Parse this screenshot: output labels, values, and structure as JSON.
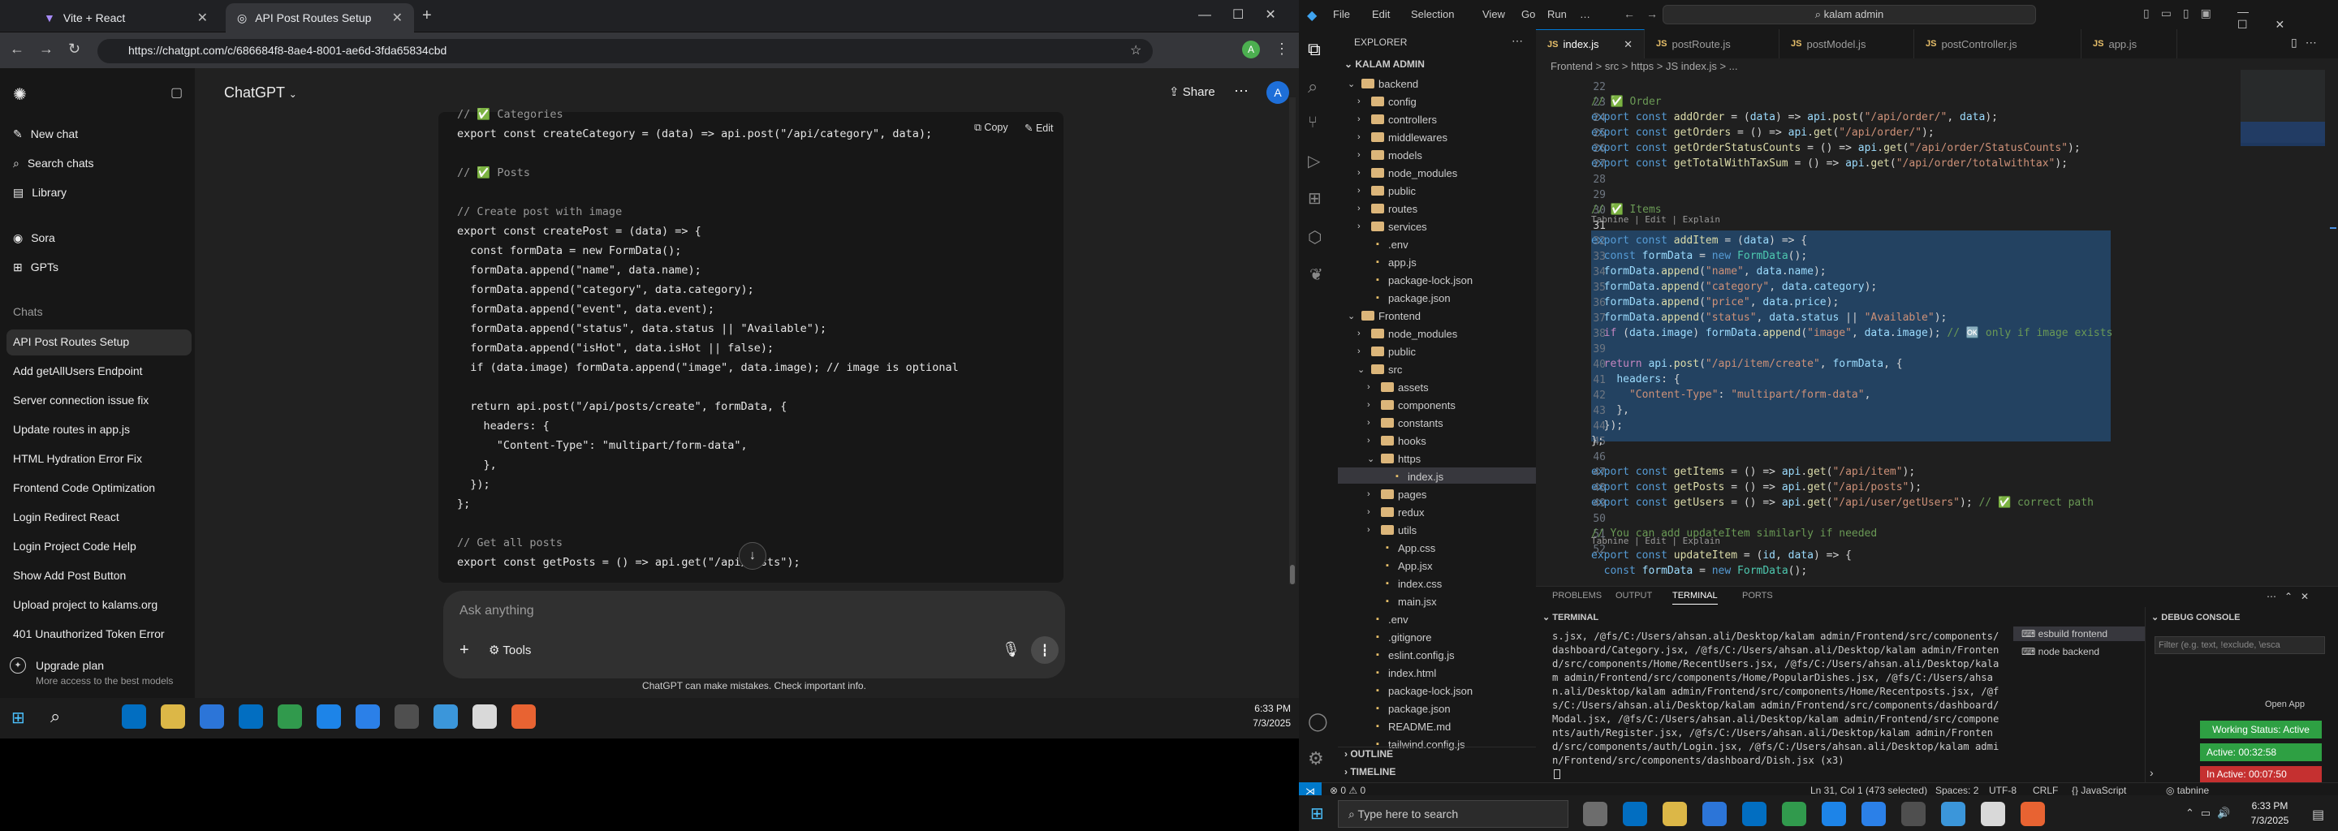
{
  "chrome": {
    "tabs": [
      "Vite + React",
      "API Post Routes Setup"
    ],
    "url": "https://chatgpt.com/c/686684f8-8ae4-8001-ae6d-3fda65834cbd"
  },
  "chatgpt": {
    "brand": "ChatGPT",
    "nav": [
      "New chat",
      "Search chats",
      "Library",
      "Sora",
      "GPTs"
    ],
    "chats_heading": "Chats",
    "history": [
      "API Post Routes Setup",
      "Add getAllUsers Endpoint",
      "Server connection issue fix",
      "Update routes in app.js",
      "HTML Hydration Error Fix",
      "Frontend Code Optimization",
      "Login Redirect React",
      "Login Project Code Help",
      "Show Add Post Button",
      "Upload project to kalams.org",
      "401 Unauthorized Token Error"
    ],
    "upgrade_title": "Upgrade plan",
    "upgrade_sub": "More access to the best models",
    "share": "Share",
    "avatar": "A",
    "copy": "Copy",
    "edit": "Edit",
    "code_lines": [
      "// ✅ Categories",
      "export const createCategory = (data) => api.post(\"/api/category\", data);",
      "",
      "// ✅ Posts",
      "",
      "// Create post with image",
      "export const createPost = (data) => {",
      "  const formData = new FormData();",
      "  formData.append(\"name\", data.name);",
      "  formData.append(\"category\", data.category);",
      "  formData.append(\"event\", data.event);",
      "  formData.append(\"status\", data.status || \"Available\");",
      "  formData.append(\"isHot\", data.isHot || false);",
      "  if (data.image) formData.append(\"image\", data.image); // image is optional",
      "",
      "  return api.post(\"/api/posts/create\", formData, {",
      "    headers: {",
      "      \"Content-Type\": \"multipart/form-data\",",
      "    },",
      "  });",
      "};",
      "",
      "// Get all posts",
      "export const getPosts = () => api.get(\"/api/posts\");"
    ],
    "ask_placeholder": "Ask anything",
    "tools": "Tools",
    "disclaimer": "ChatGPT can make mistakes. Check important info."
  },
  "taskbar_left": {
    "time": "6:33 PM",
    "date": "7/3/2025"
  },
  "vscode": {
    "menu": [
      "File",
      "Edit",
      "Selection",
      "View",
      "Go",
      "Run",
      "…"
    ],
    "search": "kalam admin",
    "explorer_title": "EXPLORER",
    "workspace": "KALAM ADMIN",
    "tree": [
      {
        "name": "backend",
        "depth": 0,
        "type": "folder-open"
      },
      {
        "name": "config",
        "depth": 1,
        "type": "folder"
      },
      {
        "name": "controllers",
        "depth": 1,
        "type": "folder"
      },
      {
        "name": "middlewares",
        "depth": 1,
        "type": "folder"
      },
      {
        "name": "models",
        "depth": 1,
        "type": "folder"
      },
      {
        "name": "node_modules",
        "depth": 1,
        "type": "folder"
      },
      {
        "name": "public",
        "depth": 1,
        "type": "folder"
      },
      {
        "name": "routes",
        "depth": 1,
        "type": "folder"
      },
      {
        "name": "services",
        "depth": 1,
        "type": "folder"
      },
      {
        "name": ".env",
        "depth": 1,
        "type": "file"
      },
      {
        "name": "app.js",
        "depth": 1,
        "type": "file"
      },
      {
        "name": "package-lock.json",
        "depth": 1,
        "type": "file"
      },
      {
        "name": "package.json",
        "depth": 1,
        "type": "file"
      },
      {
        "name": "Frontend",
        "depth": 0,
        "type": "folder-open"
      },
      {
        "name": "node_modules",
        "depth": 1,
        "type": "folder"
      },
      {
        "name": "public",
        "depth": 1,
        "type": "folder"
      },
      {
        "name": "src",
        "depth": 1,
        "type": "folder-open"
      },
      {
        "name": "assets",
        "depth": 2,
        "type": "folder"
      },
      {
        "name": "components",
        "depth": 2,
        "type": "folder"
      },
      {
        "name": "constants",
        "depth": 2,
        "type": "folder"
      },
      {
        "name": "hooks",
        "depth": 2,
        "type": "folder"
      },
      {
        "name": "https",
        "depth": 2,
        "type": "folder-open"
      },
      {
        "name": "index.js",
        "depth": 3,
        "type": "file",
        "selected": true
      },
      {
        "name": "pages",
        "depth": 2,
        "type": "folder"
      },
      {
        "name": "redux",
        "depth": 2,
        "type": "folder"
      },
      {
        "name": "utils",
        "depth": 2,
        "type": "folder"
      },
      {
        "name": "App.css",
        "depth": 2,
        "type": "file"
      },
      {
        "name": "App.jsx",
        "depth": 2,
        "type": "file"
      },
      {
        "name": "index.css",
        "depth": 2,
        "type": "file"
      },
      {
        "name": "main.jsx",
        "depth": 2,
        "type": "file"
      },
      {
        "name": ".env",
        "depth": 1,
        "type": "file"
      },
      {
        "name": ".gitignore",
        "depth": 1,
        "type": "file"
      },
      {
        "name": "eslint.config.js",
        "depth": 1,
        "type": "file"
      },
      {
        "name": "index.html",
        "depth": 1,
        "type": "file"
      },
      {
        "name": "package-lock.json",
        "depth": 1,
        "type": "file"
      },
      {
        "name": "package.json",
        "depth": 1,
        "type": "file"
      },
      {
        "name": "README.md",
        "depth": 1,
        "type": "file"
      },
      {
        "name": "tailwind.config.js",
        "depth": 1,
        "type": "file"
      }
    ],
    "outline": "OUTLINE",
    "timeline": "TIMELINE",
    "tabs": [
      "index.js",
      "postRoute.js",
      "postModel.js",
      "postController.js",
      "app.js"
    ],
    "breadcrumb": "Frontend > src > https > JS index.js > ...",
    "codelens": "Tabnine | Edit | Explain",
    "line_numbers": [
      22,
      23,
      24,
      25,
      26,
      27,
      28,
      29,
      30,
      31,
      32,
      33,
      34,
      35,
      36,
      37,
      38,
      39,
      40,
      41,
      42,
      43,
      44,
      45,
      46,
      47,
      48,
      49,
      50,
      51,
      52
    ],
    "panel_tabs": [
      "PROBLEMS",
      "OUTPUT",
      "TERMINAL",
      "PORTS"
    ],
    "terminal_label": "TERMINAL",
    "terminal_text": "s.jsx, /@fs/C:/Users/ahsan.ali/Desktop/kalam admin/Frontend/src/components/dashboard/Category.jsx, /@fs/C:/Users/ahsan.ali/Desktop/kalam admin/Frontend/src/components/Home/RecentUsers.jsx, /@fs/C:/Users/ahsan.ali/Desktop/kalam admin/Frontend/src/components/Home/PopularDishes.jsx, /@fs/C:/Users/ahsan.ali/Desktop/kalam admin/Frontend/src/components/Home/Recentposts.jsx, /@fs/C:/Users/ahsan.ali/Desktop/kalam admin/Frontend/src/components/dashboard/Modal.jsx, /@fs/C:/Users/ahsan.ali/Desktop/kalam admin/Frontend/src/components/auth/Register.jsx, /@fs/C:/Users/ahsan.ali/Desktop/kalam admin/Frontend/src/components/auth/Login.jsx, /@fs/C:/Users/ahsan.ali/Desktop/kalam admin/Frontend/src/components/dashboard/Dish.jsx (x3)",
    "terminals": [
      "esbuild frontend",
      "node backend"
    ],
    "debug_console": "DEBUG CONSOLE",
    "filter_placeholder": "Filter (e.g. text, !exclude, \\esca",
    "open_app": "Open App",
    "working_status": "Working Status: Active",
    "active_time": "Active: 00:32:58",
    "inactive_time": "In Active: 00:07:50",
    "status_left": "⊗ 0 ⚠ 0",
    "status_right": [
      "Ln 31, Col 1 (473 selected)",
      "Spaces: 2",
      "UTF-8",
      "CRLF",
      "{} JavaScript",
      "◎ tabnine"
    ],
    "start_search": "Type here to search",
    "time": "6:33 PM",
    "date": "7/3/2025"
  },
  "colors": {
    "chatgpt_bg": "#212121",
    "vscode_bg": "#1f1f1f",
    "accent": "#007acc",
    "working": "#2ea043",
    "inactive": "#c53030"
  }
}
